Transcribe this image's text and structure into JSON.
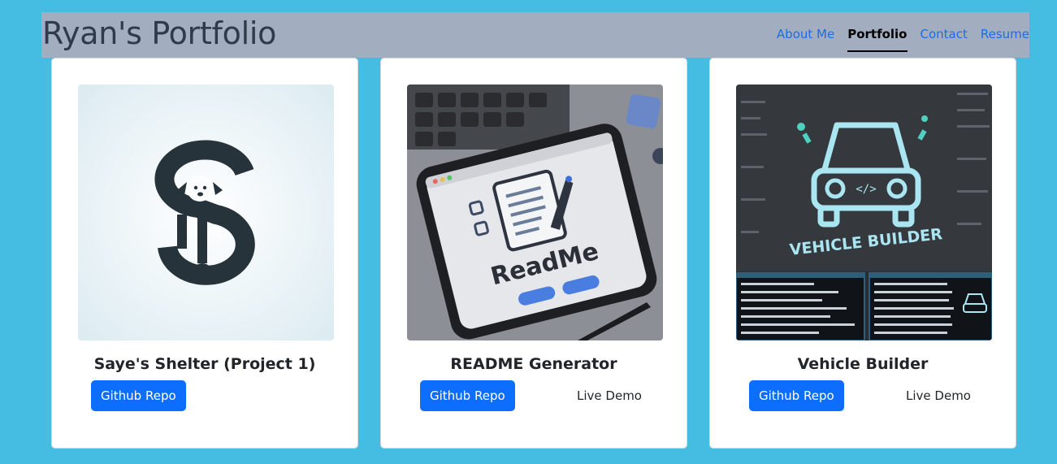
{
  "header": {
    "title": "Ryan's Portfolio",
    "nav": [
      {
        "label": "About Me",
        "active": false
      },
      {
        "label": "Portfolio",
        "active": true
      },
      {
        "label": "Contact",
        "active": false
      },
      {
        "label": "Resume",
        "active": false
      }
    ]
  },
  "projects": [
    {
      "title": "Saye's Shelter (Project 1)",
      "image_icon": "dollar-dog-logo",
      "repo_label": "Github Repo",
      "demo_label": null
    },
    {
      "title": "README Generator",
      "image_icon": "readme-tablet",
      "image_text": "ReadMe",
      "repo_label": "Github Repo",
      "demo_label": "Live Demo"
    },
    {
      "title": "Vehicle Builder",
      "image_icon": "car-neon",
      "image_text": "VEHICLE BUILDER",
      "repo_label": "Github Repo",
      "demo_label": "Live Demo"
    }
  ],
  "colors": {
    "page_bg": "#45bde2",
    "header_bg": "#a2aebf",
    "nav_link": "#1d6ce6",
    "primary_button": "#0d6efd"
  }
}
